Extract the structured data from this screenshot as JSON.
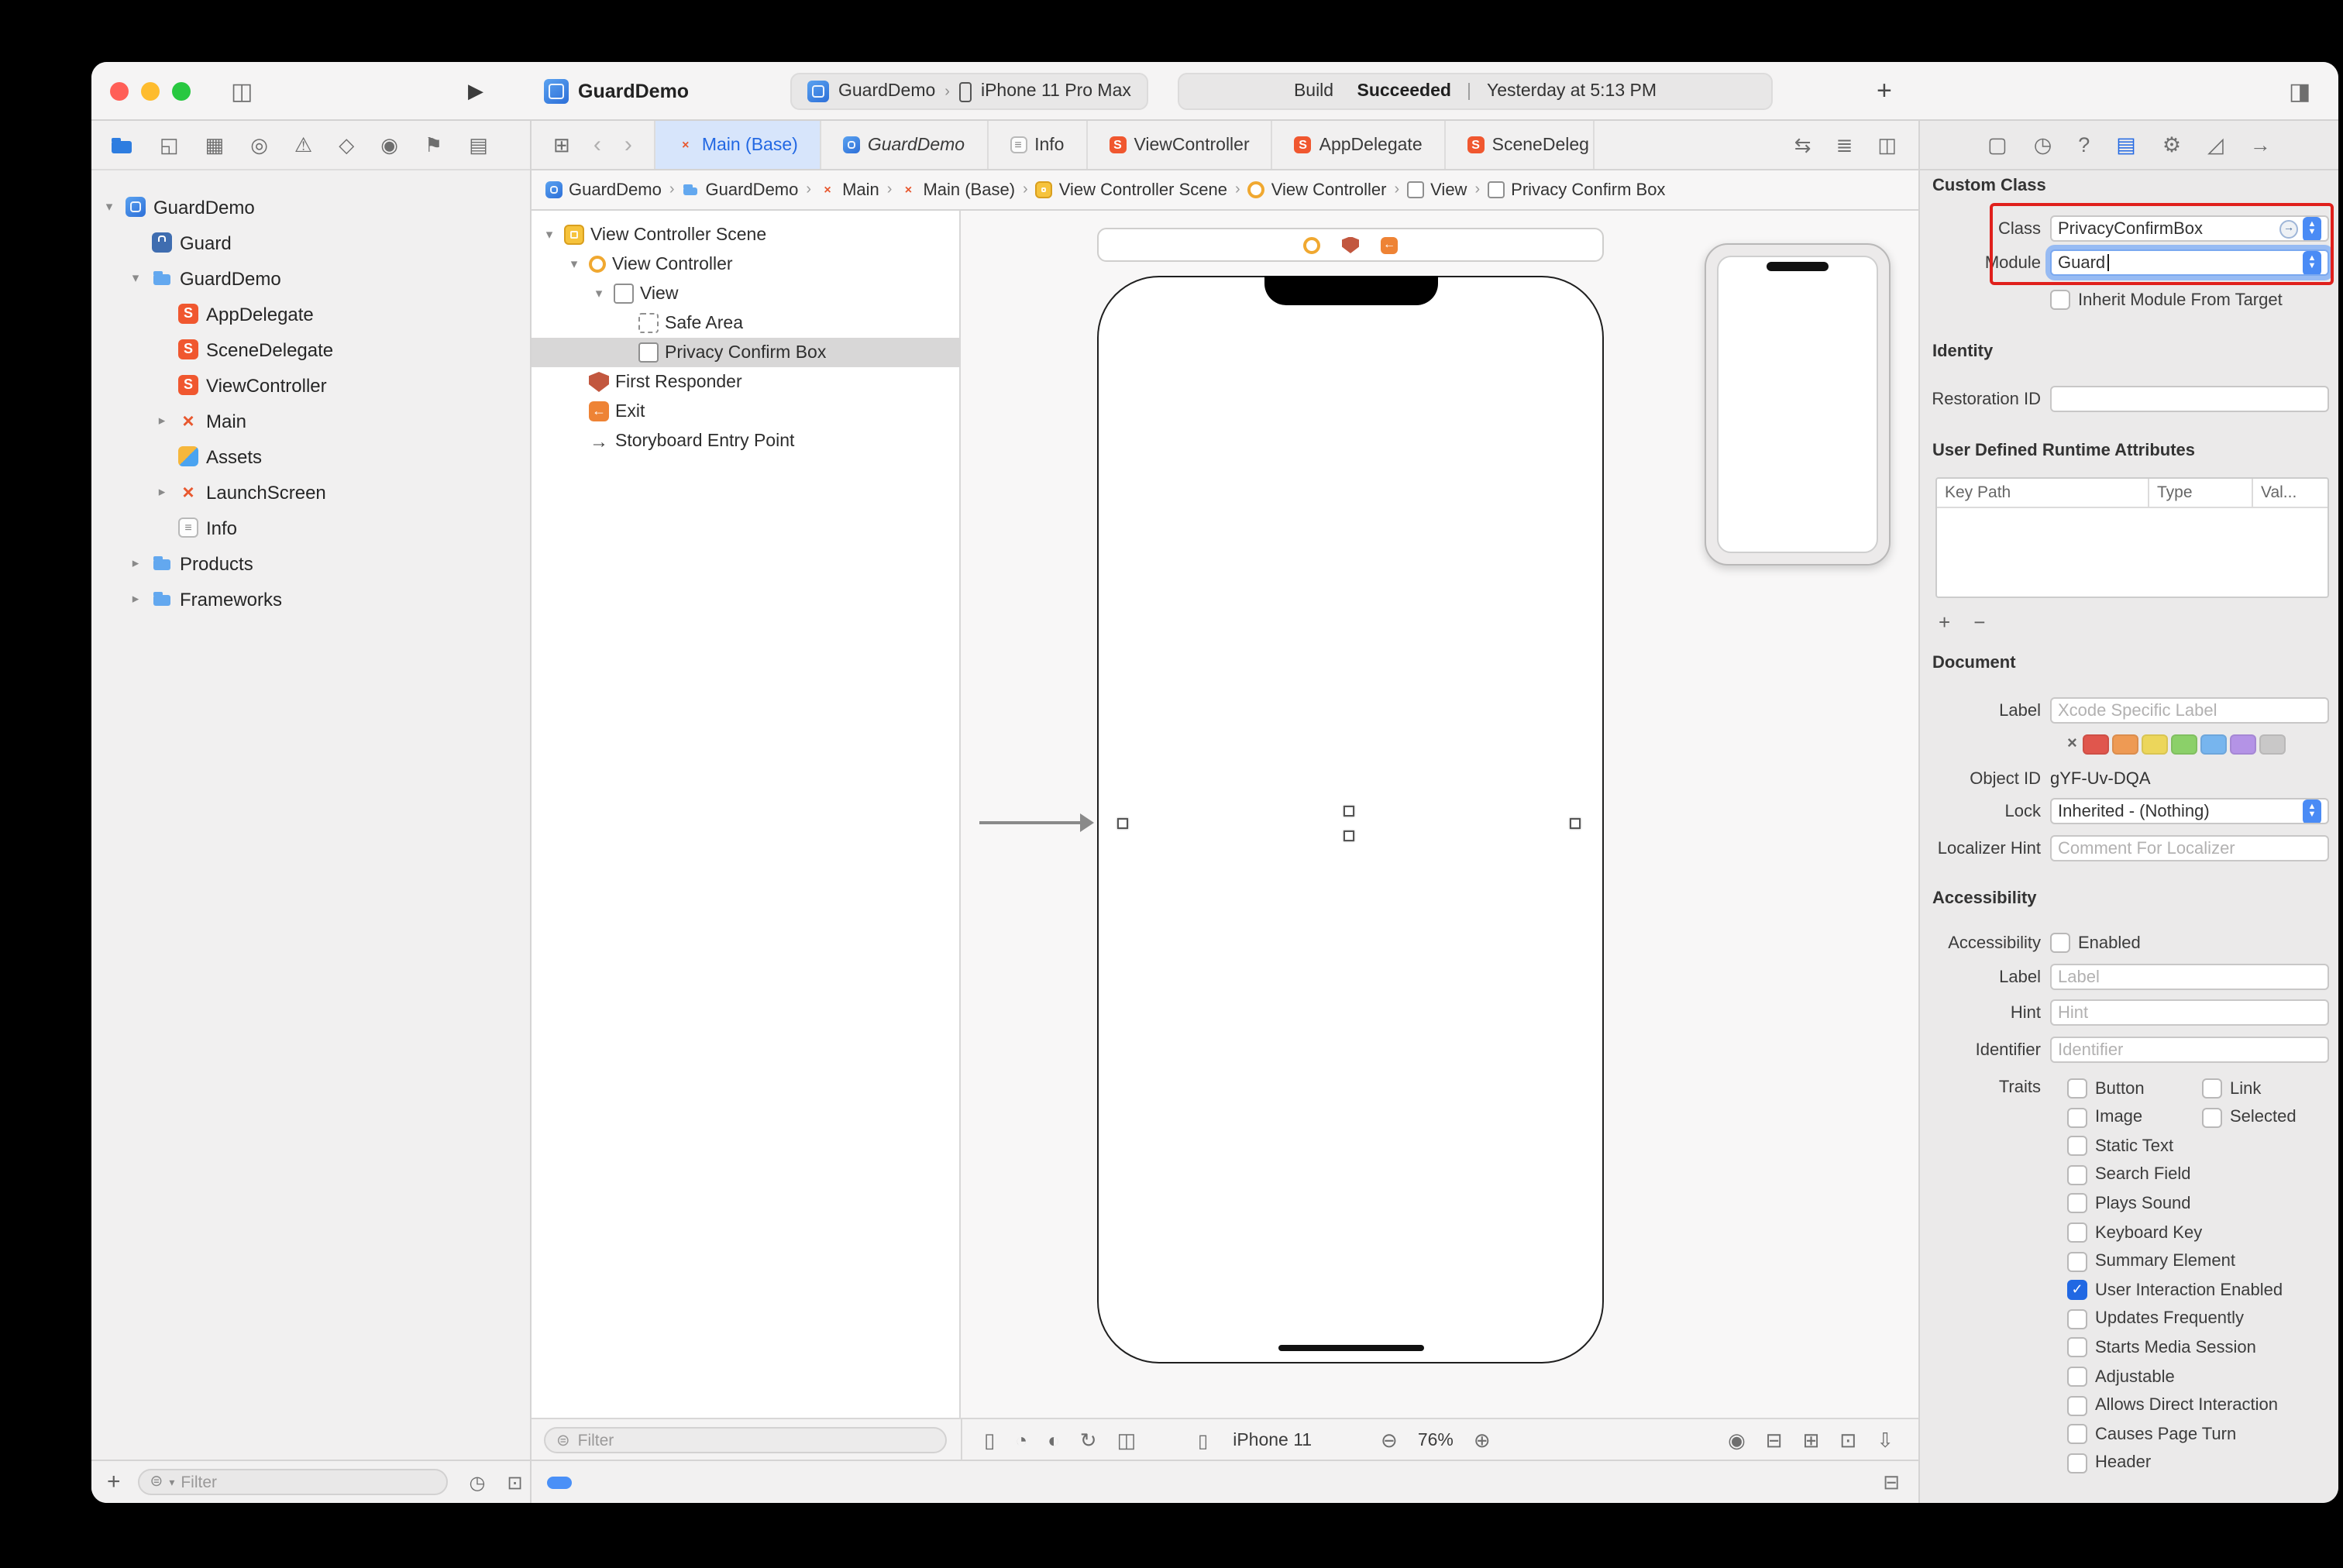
{
  "theme": {
    "accent_blue": "#2268e3",
    "tab_selection_blue": "#d7e5fb",
    "annotation_red": "#e0201c",
    "traffic_red": "#ff5f57",
    "traffic_yellow": "#febc2e",
    "traffic_green": "#28c840",
    "xcode_orange": "#ee8335"
  },
  "toolbar": {
    "window_title": "GuardDemo",
    "icons": {
      "sidebar_toggle": "◫",
      "run": "▶",
      "add_tab": "+",
      "panel_toggle": "◨"
    },
    "scheme": {
      "name": "GuardDemo",
      "separator": "›",
      "destination": "iPhone 11 Pro Max"
    },
    "status": {
      "action": "Build",
      "result": "Succeeded",
      "divider": "|",
      "time": "Yesterday at 5:13 PM"
    }
  },
  "navigator": {
    "toolbar_icons": [
      {
        "name": "project-navigator-icon",
        "glyph": "folder",
        "active": true
      },
      {
        "name": "source-control-navigator-icon",
        "glyph": "◱"
      },
      {
        "name": "symbol-navigator-icon",
        "glyph": "▦"
      },
      {
        "name": "find-navigator-icon",
        "glyph": "◎"
      },
      {
        "name": "issue-navigator-icon",
        "glyph": "⚠"
      },
      {
        "name": "test-navigator-icon",
        "glyph": "◇"
      },
      {
        "name": "debug-navigator-icon",
        "glyph": "◉"
      },
      {
        "name": "breakpoint-navigator-icon",
        "glyph": "⚑"
      },
      {
        "name": "report-navigator-icon",
        "glyph": "▤"
      }
    ],
    "items": [
      {
        "label": "GuardDemo",
        "icon": "app",
        "level": 0,
        "disclosure": "open"
      },
      {
        "label": "Guard",
        "icon": "target",
        "level": 1
      },
      {
        "label": "GuardDemo",
        "icon": "folder",
        "level": 1,
        "disclosure": "open"
      },
      {
        "label": "AppDelegate",
        "icon": "swift",
        "level": 2
      },
      {
        "label": "SceneDelegate",
        "icon": "swift",
        "level": 2
      },
      {
        "label": "ViewController",
        "icon": "swift",
        "level": 2
      },
      {
        "label": "Main",
        "icon": "storyboard",
        "level": 2,
        "disclosure": "closed"
      },
      {
        "label": "Assets",
        "icon": "assets",
        "level": 2
      },
      {
        "label": "LaunchScreen",
        "icon": "storyboard",
        "level": 2,
        "disclosure": "closed"
      },
      {
        "label": "Info",
        "icon": "plist",
        "level": 2
      },
      {
        "label": "Products",
        "icon": "folder",
        "level": 1,
        "disclosure": "closed"
      },
      {
        "label": "Frameworks",
        "icon": "folder",
        "level": 1,
        "disclosure": "closed"
      }
    ],
    "bottom": {
      "add_glyph": "+",
      "filter_icon_glyph": "⊜",
      "filter_chevron": "▾",
      "filter_placeholder": "Filter",
      "icons": [
        {
          "name": "recents-filter-icon",
          "glyph": "◷"
        },
        {
          "name": "scm-filter-icon",
          "glyph": "⊡"
        }
      ]
    }
  },
  "editor": {
    "nav_icons": {
      "overview": "⊞",
      "back": "‹",
      "forward": "›"
    },
    "tabs": [
      {
        "label": "Main (Base)",
        "icon": "storyboard",
        "active": true
      },
      {
        "label": "GuardDemo",
        "icon": "app",
        "italic": true
      },
      {
        "label": "Info",
        "icon": "plist"
      },
      {
        "label": "ViewController",
        "icon": "swift"
      },
      {
        "label": "AppDelegate",
        "icon": "swift"
      },
      {
        "label": "SceneDeleg",
        "icon": "swift",
        "cut": true
      }
    ],
    "right_icons": [
      {
        "name": "code-review-icon",
        "glyph": "⇆"
      },
      {
        "name": "editor-adjust-icon",
        "glyph": "≣"
      },
      {
        "name": "editor-options-icon",
        "glyph": "◫"
      }
    ],
    "breadcrumbs": [
      {
        "label": "GuardDemo",
        "icon": "app"
      },
      {
        "label": "GuardDemo",
        "icon": "folder"
      },
      {
        "label": "Main",
        "icon": "storyboard"
      },
      {
        "label": "Main (Base)",
        "icon": "storyboard"
      },
      {
        "label": "View Controller Scene",
        "icon": "vcscene"
      },
      {
        "label": "View Controller",
        "icon": "vc"
      },
      {
        "label": "View",
        "icon": "view"
      },
      {
        "label": "Privacy Confirm Box",
        "icon": "view"
      }
    ],
    "chevron": "›",
    "bottom_toggle_glyph": "⊟"
  },
  "outline": {
    "items": [
      {
        "label": "View Controller Scene",
        "icon": "vcscene",
        "level": 0,
        "disclosure": "open"
      },
      {
        "label": "View Controller",
        "icon": "vc",
        "level": 1,
        "disclosure": "open"
      },
      {
        "label": "View",
        "icon": "view",
        "level": 2,
        "disclosure": "open"
      },
      {
        "label": "Safe Area",
        "icon": "safearea",
        "level": 3
      },
      {
        "label": "Privacy Confirm Box",
        "icon": "view",
        "level": 3,
        "selected": true
      },
      {
        "label": "First Responder",
        "icon": "responder",
        "level": 1
      },
      {
        "label": "Exit",
        "icon": "exit",
        "level": 1
      },
      {
        "label": "Storyboard Entry Point",
        "icon": "entry",
        "level": 1
      }
    ],
    "filter_icon_glyph": "⊜",
    "filter_placeholder": "Filter"
  },
  "canvas": {
    "dock_icons": [
      {
        "name": "view-controller-dock-icon",
        "type": "vc"
      },
      {
        "name": "first-responder-dock-icon",
        "type": "responder"
      },
      {
        "name": "exit-dock-icon",
        "type": "exit"
      }
    ],
    "bottom_left_icons": [
      {
        "name": "device-bezel-icon",
        "glyph": "▯"
      },
      {
        "name": "accessibility-preview-icon",
        "glyph": "◔"
      },
      {
        "name": "appearance-icon",
        "glyph": "◐"
      },
      {
        "name": "orientation-icon",
        "glyph": "↻"
      },
      {
        "name": "adaptation-icon",
        "glyph": "◫"
      }
    ],
    "device_name": "iPhone 11",
    "zoom_out_glyph": "⊖",
    "zoom_level": "76%",
    "zoom_in_glyph": "⊕",
    "bottom_right_icons": [
      {
        "name": "update-frames-icon",
        "glyph": "◉"
      },
      {
        "name": "embed-in-stack-icon",
        "glyph": "⊟"
      },
      {
        "name": "align-icon",
        "glyph": "⊞"
      },
      {
        "name": "pin-constraints-icon",
        "glyph": "⊡"
      },
      {
        "name": "resolve-layout-icon",
        "glyph": "⇩"
      }
    ]
  },
  "inspector": {
    "tab_icons": [
      {
        "name": "file-inspector-icon",
        "glyph": "▢"
      },
      {
        "name": "history-inspector-icon",
        "glyph": "◷"
      },
      {
        "name": "quick-help-inspector-icon",
        "glyph": "?"
      },
      {
        "name": "identity-inspector-icon",
        "glyph": "▤",
        "active": true
      },
      {
        "name": "attributes-inspector-icon",
        "glyph": "⚙"
      },
      {
        "name": "size-inspector-icon",
        "glyph": "◿"
      },
      {
        "name": "connections-inspector-icon",
        "glyph": "→"
      }
    ],
    "custom_class": {
      "title": "Custom Class",
      "class_label": "Class",
      "class_value": "PrivacyConfirmBox",
      "module_label": "Module",
      "module_value": "Guard",
      "inherit_label": "Inherit Module From Target"
    },
    "identity": {
      "title": "Identity",
      "restoration_id_label": "Restoration ID"
    },
    "runtime_attributes": {
      "title": "User Defined Runtime Attributes",
      "columns": [
        "Key Path",
        "Type",
        "Val..."
      ],
      "add_glyph": "+",
      "remove_glyph": "−"
    },
    "document": {
      "title": "Document",
      "label_label": "Label",
      "label_placeholder": "Xcode Specific Label",
      "swatch_clear": "×",
      "swatches": [
        "#e0564d",
        "#ee9a54",
        "#ecd65b",
        "#8bd069",
        "#77b5ee",
        "#b493e6",
        "#c9c8c8"
      ],
      "object_id_label": "Object ID",
      "object_id_value": "gYF-Uv-DQA",
      "lock_label": "Lock",
      "lock_value": "Inherited - (Nothing)",
      "localizer_label": "Localizer Hint",
      "localizer_placeholder": "Comment For Localizer"
    },
    "accessibility": {
      "title": "Accessibility",
      "accessibility_label": "Accessibility",
      "enabled_label": "Enabled",
      "label_label": "Label",
      "label_placeholder": "Label",
      "hint_label": "Hint",
      "hint_placeholder": "Hint",
      "identifier_label": "Identifier",
      "identifier_placeholder": "Identifier",
      "traits_label": "Traits",
      "trait_rows": [
        [
          {
            "label": "Button",
            "checked": false
          },
          {
            "label": "Link",
            "checked": false
          }
        ],
        [
          {
            "label": "Image",
            "checked": false
          },
          {
            "label": "Selected",
            "checked": false
          }
        ],
        [
          {
            "label": "Static Text",
            "checked": false
          }
        ],
        [
          {
            "label": "Search Field",
            "checked": false
          }
        ],
        [
          {
            "label": "Plays Sound",
            "checked": false
          }
        ],
        [
          {
            "label": "Keyboard Key",
            "checked": false
          }
        ],
        [
          {
            "label": "Summary Element",
            "checked": false
          }
        ],
        [
          {
            "label": "User Interaction Enabled",
            "checked": true
          }
        ],
        [
          {
            "label": "Updates Frequently",
            "checked": false
          }
        ],
        [
          {
            "label": "Starts Media Session",
            "checked": false
          }
        ],
        [
          {
            "label": "Adjustable",
            "checked": false
          }
        ],
        [
          {
            "label": "Allows Direct Interaction",
            "checked": false
          }
        ],
        [
          {
            "label": "Causes Page Turn",
            "checked": false
          }
        ],
        [
          {
            "label": "Header",
            "checked": false
          }
        ]
      ]
    }
  }
}
